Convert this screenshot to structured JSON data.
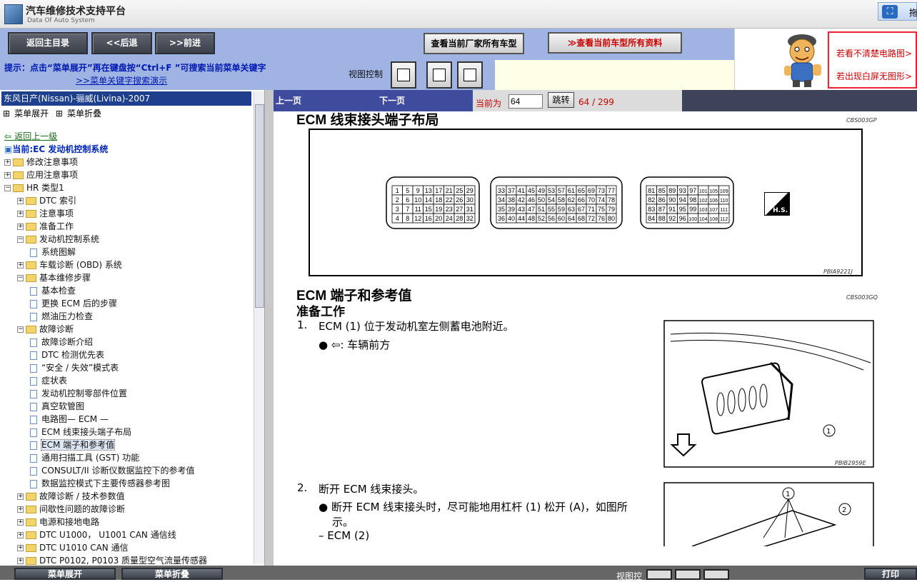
{
  "app": {
    "title": "汽车维修技术支持平台",
    "subtitle": "Data Of Auto System",
    "top_right_btn": "拖"
  },
  "nav": {
    "home": "返回主目录",
    "back": "<<后退",
    "forward": ">>前进",
    "view_all_models": "查看当前厂家所有车型",
    "view_all_data": "查看当前车型所有资料"
  },
  "ads": {
    "line1": "若看不清楚电路图>",
    "line2": "若出现白屏无图形>"
  },
  "hint": {
    "line1": "提示：点击“菜单展开”再在键盘按“Ctrl+F ”可搜索当前菜单关键字",
    "line2": ">>菜单关键字搜索演示",
    "view_control": "视图控制"
  },
  "left": {
    "header": "东风日产(Nissan)-骊威(Livina)-2007",
    "expand": "菜单展开",
    "collapse": "菜单折叠",
    "back_up": "返回上一级",
    "current": "当前:EC 发动机控制系统",
    "tree": [
      {
        "label": "修改注意事项",
        "lv": 0,
        "t": "folder"
      },
      {
        "label": "应用注意事项",
        "lv": 0,
        "t": "folder"
      },
      {
        "label": "HR 类型1",
        "lv": 0,
        "t": "folder-open"
      },
      {
        "label": "DTC 索引",
        "lv": 1,
        "t": "folder"
      },
      {
        "label": "注意事项",
        "lv": 1,
        "t": "folder"
      },
      {
        "label": "准备工作",
        "lv": 1,
        "t": "folder"
      },
      {
        "label": "发动机控制系统",
        "lv": 1,
        "t": "folder-open"
      },
      {
        "label": "系统图解",
        "lv": 2,
        "t": "doc"
      },
      {
        "label": "车载诊断 (OBD) 系统",
        "lv": 1,
        "t": "folder"
      },
      {
        "label": "基本维修步骤",
        "lv": 1,
        "t": "folder-open"
      },
      {
        "label": "基本检查",
        "lv": 2,
        "t": "doc"
      },
      {
        "label": "更换 ECM 后的步骤",
        "lv": 2,
        "t": "doc"
      },
      {
        "label": "燃油压力检查",
        "lv": 2,
        "t": "doc"
      },
      {
        "label": "故障诊断",
        "lv": 1,
        "t": "folder-open"
      },
      {
        "label": "故障诊断介绍",
        "lv": 2,
        "t": "doc"
      },
      {
        "label": "DTC 检测优先表",
        "lv": 2,
        "t": "doc"
      },
      {
        "label": "“安全 / 失效”模式表",
        "lv": 2,
        "t": "doc"
      },
      {
        "label": "症状表",
        "lv": 2,
        "t": "doc"
      },
      {
        "label": "发动机控制零部件位置",
        "lv": 2,
        "t": "doc"
      },
      {
        "label": "真空软管图",
        "lv": 2,
        "t": "doc"
      },
      {
        "label": "电路图— ECM —",
        "lv": 2,
        "t": "doc"
      },
      {
        "label": "ECM 线束接头端子布局",
        "lv": 2,
        "t": "doc"
      },
      {
        "label": "ECM 端子和参考值",
        "lv": 2,
        "t": "doc",
        "sel": true
      },
      {
        "label": "通用扫描工具 (GST) 功能",
        "lv": 2,
        "t": "doc"
      },
      {
        "label": "CONSULT/II 诊断仪数据监控下的参考值",
        "lv": 2,
        "t": "doc"
      },
      {
        "label": "数据监控模式下主要传感器参考图",
        "lv": 2,
        "t": "doc"
      },
      {
        "label": "故障诊断 / 技术参数值",
        "lv": 1,
        "t": "folder"
      },
      {
        "label": "间歇性问题的故障诊断",
        "lv": 1,
        "t": "folder"
      },
      {
        "label": "电源和接地电路",
        "lv": 1,
        "t": "folder"
      },
      {
        "label": "DTC U1000， U1001 CAN 通信线",
        "lv": 1,
        "t": "folder"
      },
      {
        "label": "DTC U1010 CAN 通信",
        "lv": 1,
        "t": "folder"
      },
      {
        "label": "DTC P0102, P0103 质量型空气流量传感器",
        "lv": 1,
        "t": "folder"
      }
    ]
  },
  "pager": {
    "prev": "上一页",
    "next": "下一页",
    "current_label": "当前为",
    "page": "64",
    "jump": "跳转",
    "count": "64 / 299"
  },
  "doc": {
    "h_layout": "ECM 线束接头端子布局",
    "code1": "CBS003GP",
    "fig1": "PBIA9221J",
    "hs": "H.S.",
    "h_ref": "ECM 端子和参考值",
    "code2": "CBS003GQ",
    "h_prep": "准备工作",
    "s1_num": "1.",
    "s1": "ECM (1) 位于发动机室左侧蓄电池附近。",
    "s1b": ": 车辆前方",
    "fig2": "PBIB2959E",
    "s2_num": "2.",
    "s2": "断开 ECM 线束接头。",
    "s2b1": "断开 ECM 线束接头时，尽可能地用杠杆 (1) 松开 (A)，如图所",
    "s2b1c": "示。",
    "s2b2": "ECM (2)"
  },
  "connectors": {
    "c1": [
      [
        "1",
        "5",
        "9",
        "13",
        "17",
        "21",
        "25",
        "29"
      ],
      [
        "2",
        "6",
        "10",
        "14",
        "18",
        "22",
        "26",
        "30"
      ],
      [
        "3",
        "7",
        "11",
        "15",
        "19",
        "23",
        "27",
        "31"
      ],
      [
        "4",
        "8",
        "12",
        "16",
        "20",
        "24",
        "28",
        "32"
      ]
    ],
    "c2": [
      [
        "33",
        "37",
        "41",
        "45",
        "49",
        "53",
        "57",
        "61",
        "65",
        "69",
        "73",
        "77"
      ],
      [
        "34",
        "38",
        "42",
        "46",
        "50",
        "54",
        "58",
        "62",
        "66",
        "70",
        "74",
        "78"
      ],
      [
        "35",
        "39",
        "43",
        "47",
        "51",
        "55",
        "59",
        "63",
        "67",
        "71",
        "75",
        "79"
      ],
      [
        "36",
        "40",
        "44",
        "48",
        "52",
        "56",
        "60",
        "64",
        "68",
        "72",
        "76",
        "80"
      ]
    ],
    "c3": [
      [
        "81",
        "85",
        "89",
        "93",
        "97",
        "101",
        "105",
        "109"
      ],
      [
        "82",
        "86",
        "90",
        "94",
        "98",
        "102",
        "106",
        "110"
      ],
      [
        "83",
        "87",
        "91",
        "95",
        "99",
        "103",
        "107",
        "111"
      ],
      [
        "84",
        "88",
        "92",
        "96",
        "100",
        "104",
        "108",
        "112"
      ]
    ]
  },
  "bottom": {
    "expand": "菜单展开",
    "collapse": "菜单折叠",
    "view": "视图控",
    "print": "打印"
  }
}
